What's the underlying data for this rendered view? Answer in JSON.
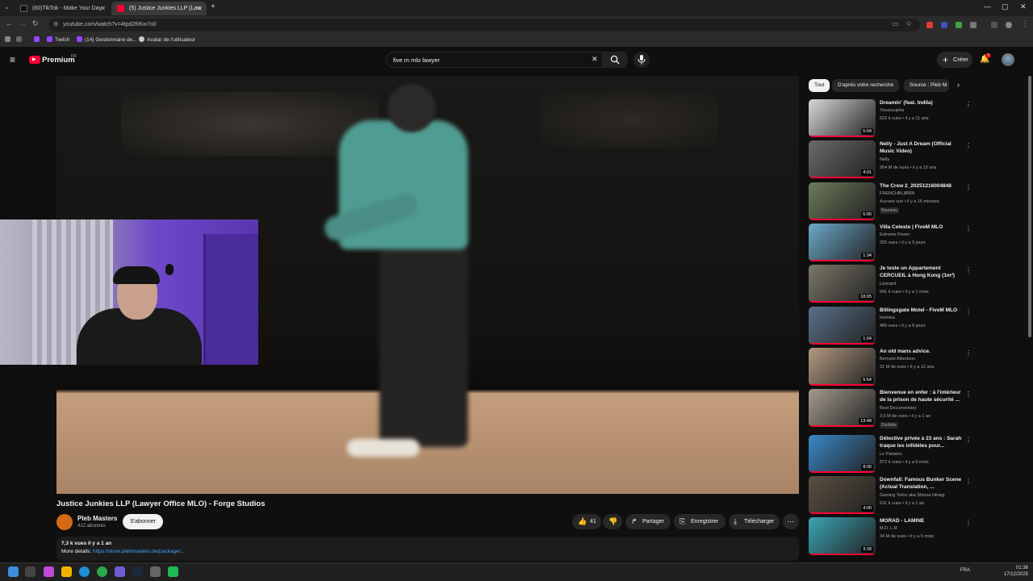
{
  "browser": {
    "tabs": [
      {
        "title": "(60)TikTok - Make Your Day",
        "active": false
      },
      {
        "title": "(5) Justice Junkies LLP (Law",
        "active": true
      }
    ],
    "url": "youtube.com/watch?v=4tpd2RKw7o0",
    "bookmarks": [
      "Twitch",
      "(14) Gestionnaire de...",
      "Avatar de l'utilisateur"
    ]
  },
  "youtube": {
    "logo_text": "Premium",
    "logo_region": "FR",
    "search_value": "five m mlo lawyer",
    "create_label": "Créer",
    "notif_count": "9"
  },
  "video": {
    "title": "Justice Junkies LLP (Lawyer Office MLO) - Forge Studios",
    "channel": "Pleb Masters",
    "subscribers": "412 abonnés",
    "subscribe_label": "S'abonner",
    "likes": "41",
    "share_label": "Partager",
    "save_label": "Enregistrer",
    "download_label": "Télécharger",
    "desc_meta": "7,3 k vues  il y a 1 an",
    "desc_prefix": "More details: ",
    "desc_link": "https://store.plebmasters.de/package/..."
  },
  "chips": [
    "Tout",
    "D'après votre recherche",
    "Source : Pleb M"
  ],
  "recommendations": [
    {
      "title": "Dreamin' (feat. Indila)",
      "channel": "Youssoupha",
      "meta": "622 k vues • il y a 11 ans",
      "duration": "5:04",
      "color": "#d8d8d8"
    },
    {
      "title": "Nelly - Just A Dream (Official Music Video)",
      "channel": "Nelly",
      "meta": "954 M de vues • il y a 15 ans",
      "duration": "4:01",
      "color": "#6a6a6a"
    },
    {
      "title": "The Crew 2_20251216004848",
      "channel": "FRENCHBLIØRN",
      "meta": "Aucune vue • il y a 16 minutes",
      "badge": "Nouveau",
      "duration": "5:00",
      "color": "#6c7a5a"
    },
    {
      "title": "Villa Celeste | FiveM MLO",
      "channel": "Extreme Fivem",
      "meta": "255 vues • il y a 9 jours",
      "duration": "1:34",
      "color": "#6ca7c8"
    },
    {
      "title": "Je teste un Appartement CERCUEIL à Hong Kong (1m²)",
      "channel": "Léonard",
      "meta": "941 k vues • il y a 1 mois",
      "duration": "18:05",
      "color": "#7b7768"
    },
    {
      "title": "Billingsgate Motel - FiveM MLO",
      "channel": "heimius",
      "meta": "489 vues • il y a 8 jours",
      "duration": "1:04",
      "color": "#58708a"
    },
    {
      "title": "An old mans advice.",
      "channel": "Bernard Albertson",
      "meta": "31 M de vues • il y a 12 ans",
      "duration": "5:54",
      "color": "#b39a80"
    },
    {
      "title": "Bienvenue en enfer : à l'intérieur de la prison de haute sécurité ...",
      "channel": "Best Documentary",
      "meta": "3,5 M de vues • il y a 1 an",
      "badge": "Doublée",
      "duration": "13:48",
      "color": "#a49b8e"
    },
    {
      "title": "Détective privée à 23 ans : Sarah traque les infidèles pour...",
      "channel": "Le Parisien",
      "meta": "872 k vues • il y a 5 mois",
      "duration": "8:00",
      "color": "#3a88c8"
    },
    {
      "title": "Downfall: Famous Bunker Scene (Actual Translation, ...",
      "channel": "Gaming Tohru aka Shinoa Hiiragi",
      "meta": "631 k vues • il y a 1 an",
      "duration": "4:00",
      "color": "#5a4f40"
    },
    {
      "title": "MORAD - LAMINE",
      "channel": "M.D. L.R",
      "meta": "34 M de vues • il y a 5 mois",
      "duration": "3:28",
      "color": "#3aa5b5"
    }
  ],
  "taskbar": {
    "lang": "FRA",
    "time": "01:36",
    "date": "17/12/2025"
  },
  "icons": [
    "menu-icon",
    "search-icon",
    "mic-icon",
    "bell-icon",
    "like-icon",
    "dislike-icon",
    "share-icon",
    "bookmark-icon",
    "download-icon",
    "kebab-icon"
  ]
}
